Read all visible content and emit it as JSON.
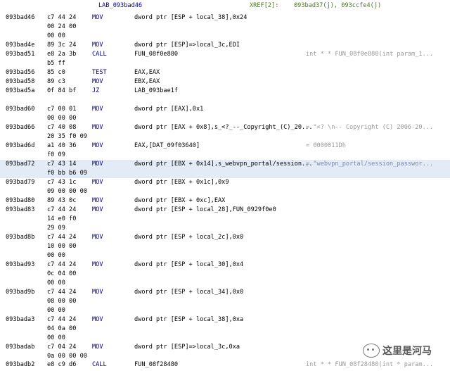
{
  "header": {
    "label": "LAB_093bad46",
    "xref_label": "XREF[2]:",
    "xref_value": "093bad37(j), 093ccfe4(j)"
  },
  "rows": [
    {
      "addr": "093bad46",
      "bytes": [
        "c7 44 24",
        "00 24 00",
        "00 00"
      ],
      "mn": "MOV",
      "op": "dword ptr [ESP + local_38],0x24",
      "cm": ""
    },
    {
      "addr": "093bad4e",
      "bytes": [
        "89 3c 24"
      ],
      "mn": "MOV",
      "op": "dword ptr [ESP]=>local_3c,EDI",
      "cm": ""
    },
    {
      "addr": "093bad51",
      "bytes": [
        "e8 2a 3b",
        "b5 ff"
      ],
      "mn": "CALL",
      "op": "FUN_08f0e880",
      "cm": "int * * FUN_08f0e880(int param_1..."
    },
    {
      "addr": "093bad56",
      "bytes": [
        "85 c0"
      ],
      "mn": "TEST",
      "op": "EAX,EAX",
      "cm": ""
    },
    {
      "addr": "093bad58",
      "bytes": [
        "89 c3"
      ],
      "mn": "MOV",
      "op": "EBX,EAX",
      "cm": ""
    },
    {
      "addr": "093bad5a",
      "bytes": [
        "0f 84 bf"
      ],
      "mn": "JZ",
      "op": "LAB_093bae1f",
      "cm": ""
    },
    {
      "addr": "093bad60",
      "bytes": [
        "c7 00 01",
        "00 00 00"
      ],
      "mn": "MOV",
      "op": "dword ptr [EAX],0x1",
      "cm": ""
    },
    {
      "addr": "093bad66",
      "bytes": [
        "c7 40 08",
        "20 35 f0 09"
      ],
      "mn": "MOV",
      "op": "dword ptr [EAX + 0x8],s_<?_--_Copyright_(C)_20...",
      "cm": "= \"<? \\n-- Copyright (C) 2006-20..."
    },
    {
      "addr": "093bad6d",
      "bytes": [
        "a1 40 36",
        "f0 09"
      ],
      "mn": "MOV",
      "op": "EAX,[DAT_09f03640]",
      "cm": "= 0000011Dh"
    },
    {
      "addr": "093bad72",
      "bytes": [
        "c7 43 14",
        "f0 bb b6 09"
      ],
      "mn": "MOV",
      "op": "dword ptr [EBX + 0x14],s_webvpn_portal/session...",
      "cm": "= \"webvpn_portal/session_passwor...",
      "hl": true
    },
    {
      "addr": "093bad79",
      "bytes": [
        "c7 43 1c",
        "09 00 00 00"
      ],
      "mn": "MOV",
      "op": "dword ptr [EBX + 0x1c],0x9",
      "cm": ""
    },
    {
      "addr": "093bad80",
      "bytes": [
        "89 43 0c"
      ],
      "mn": "MOV",
      "op": "dword ptr [EBX + 0xc],EAX",
      "cm": ""
    },
    {
      "addr": "093bad83",
      "bytes": [
        "c7 44 24",
        "14 e0 f0",
        "29 09"
      ],
      "mn": "MOV",
      "op": "dword ptr [ESP + local_28],FUN_0929f0e0",
      "cm": ""
    },
    {
      "addr": "093bad8b",
      "bytes": [
        "c7 44 24",
        "10 00 00",
        "00 00"
      ],
      "mn": "MOV",
      "op": "dword ptr [ESP + local_2c],0x0",
      "cm": ""
    },
    {
      "addr": "093bad93",
      "bytes": [
        "c7 44 24",
        "0c 04 00",
        "00 00"
      ],
      "mn": "MOV",
      "op": "dword ptr [ESP + local_30],0x4",
      "cm": ""
    },
    {
      "addr": "093bad9b",
      "bytes": [
        "c7 44 24",
        "08 00 00",
        "00 00"
      ],
      "mn": "MOV",
      "op": "dword ptr [ESP + local_34],0x0",
      "cm": ""
    },
    {
      "addr": "093bada3",
      "bytes": [
        "c7 44 24",
        "04 0a 00",
        "00 00"
      ],
      "mn": "MOV",
      "op": "dword ptr [ESP + local_38],0xa",
      "cm": ""
    },
    {
      "addr": "093badab",
      "bytes": [
        "c7 04 24",
        "0a 00 00 00"
      ],
      "mn": "MOV",
      "op": "dword ptr [ESP]=>local_3c,0xa",
      "cm": ""
    },
    {
      "addr": "093badb2",
      "bytes": [
        "e8 c9 d6"
      ],
      "mn": "CALL",
      "op": "FUN_08f28480",
      "cm": "int * * FUN_08f28480(int * param..."
    }
  ],
  "watermark": {
    "text": "这里是河马",
    "logo_icon": "wechat-icon"
  }
}
